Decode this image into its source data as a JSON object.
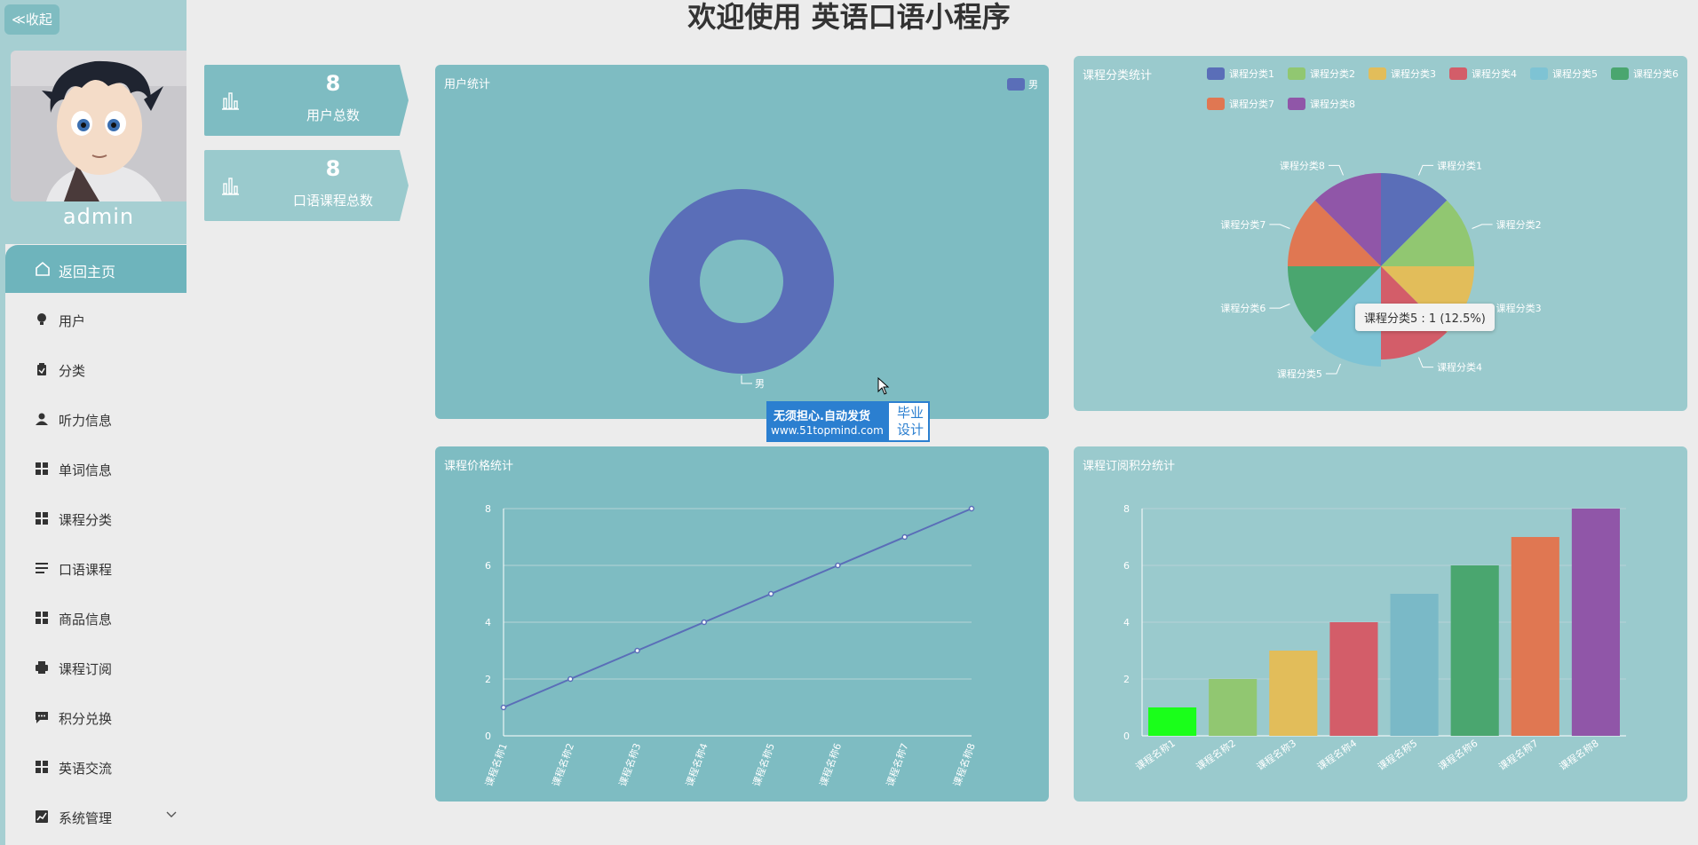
{
  "sidebar": {
    "collapse_label": "≪收起",
    "username": "admin",
    "home_label": "返回主页",
    "items": [
      {
        "label": "用户",
        "icon": "bulb-icon"
      },
      {
        "label": "分类",
        "icon": "clipboard-icon"
      },
      {
        "label": "听力信息",
        "icon": "user-icon"
      },
      {
        "label": "单词信息",
        "icon": "grid-icon"
      },
      {
        "label": "课程分类",
        "icon": "grid-icon"
      },
      {
        "label": "口语课程",
        "icon": "list-icon"
      },
      {
        "label": "商品信息",
        "icon": "grid-icon"
      },
      {
        "label": "课程订阅",
        "icon": "printer-icon"
      },
      {
        "label": "积分兑换",
        "icon": "chat-icon"
      },
      {
        "label": "英语交流",
        "icon": "grid-icon"
      },
      {
        "label": "系统管理",
        "icon": "chart-icon"
      }
    ]
  },
  "header": {
    "title": "欢迎使用 英语口语小程序"
  },
  "stats": [
    {
      "value": "8",
      "label": "用户总数"
    },
    {
      "value": "8",
      "label": "口语课程总数"
    }
  ],
  "colors": {
    "panel": "#7ebcc2",
    "panel_light": "#9acacd",
    "series_blue": "#5470c6",
    "sidebar_active": "#6eb4bc"
  },
  "watermark": {
    "line1": "无须担心.自动发货",
    "line2": "www.51topmind.com",
    "right": "毕业设计"
  },
  "tooltip": {
    "text": "课程分类5 : 1 (12.5%)"
  },
  "chart_data": [
    {
      "type": "pie",
      "title": "用户统计",
      "donut": true,
      "legend": [
        "男"
      ],
      "slices": [
        {
          "name": "男",
          "value": 8
        }
      ],
      "colors": [
        "#5a6eb8"
      ]
    },
    {
      "type": "pie",
      "title": "课程分类统计",
      "legend_position": "top",
      "slices": [
        {
          "name": "课程分类1",
          "value": 1
        },
        {
          "name": "课程分类2",
          "value": 1
        },
        {
          "name": "课程分类3",
          "value": 1
        },
        {
          "name": "课程分类4",
          "value": 1
        },
        {
          "name": "课程分类5",
          "value": 1
        },
        {
          "name": "课程分类6",
          "value": 1
        },
        {
          "name": "课程分类7",
          "value": 1
        },
        {
          "name": "课程分类8",
          "value": 1
        }
      ],
      "colors": [
        "#5a6eb8",
        "#91c771",
        "#e2bd5a",
        "#d35d69",
        "#7ec3d4",
        "#4aa66f",
        "#e07752",
        "#9056a8"
      ]
    },
    {
      "type": "line",
      "title": "课程价格统计",
      "categories": [
        "课程名称1",
        "课程名称2",
        "课程名称3",
        "课程名称4",
        "课程名称5",
        "课程名称6",
        "课程名称7",
        "课程名称8"
      ],
      "values": [
        1,
        2,
        3,
        4,
        5,
        6,
        7,
        8
      ],
      "ylim": [
        0,
        8
      ],
      "yticks": [
        0,
        2,
        4,
        6,
        8
      ],
      "grid": true,
      "color": "#5a6eb8"
    },
    {
      "type": "bar",
      "title": "课程订阅积分统计",
      "categories": [
        "课程名称1",
        "课程名称2",
        "课程名称3",
        "课程名称4",
        "课程名称5",
        "课程名称6",
        "课程名称7",
        "课程名称8"
      ],
      "values": [
        1,
        2,
        3,
        4,
        5,
        6,
        7,
        8
      ],
      "ylim": [
        0,
        8
      ],
      "yticks": [
        0,
        2,
        4,
        6,
        8
      ],
      "grid": true,
      "colors": [
        "#1aff1a",
        "#91c771",
        "#e2bd5a",
        "#d35d69",
        "#7ab9c7",
        "#4aa66f",
        "#e07752",
        "#9056a8"
      ]
    }
  ]
}
